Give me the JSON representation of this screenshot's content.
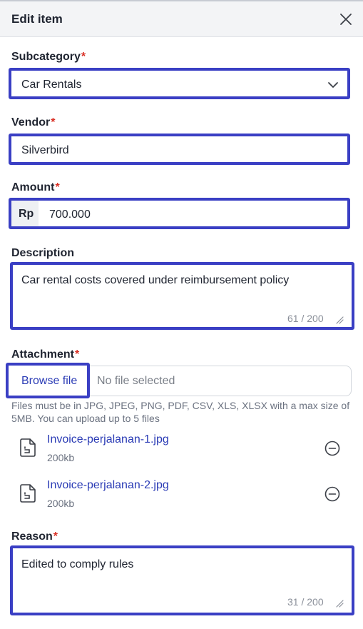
{
  "header": {
    "title": "Edit item"
  },
  "subcategory": {
    "label": "Subcategory",
    "required": "*",
    "value": "Car Rentals"
  },
  "vendor": {
    "label": "Vendor",
    "required": "*",
    "value": "Silverbird"
  },
  "amount": {
    "label": "Amount",
    "required": "*",
    "currency": "Rp",
    "value": "700.000"
  },
  "description": {
    "label": "Description",
    "value": "Car rental costs covered under reimbursement policy",
    "counter": "61 / 200"
  },
  "attachment": {
    "label": "Attachment",
    "required": "*",
    "browse_label": "Browse file",
    "status": "No file selected",
    "hint": "Files must be in JPG, JPEG, PNG, PDF, CSV, XLS, XLSX with a max size of 5MB. You can upload up to 5 files",
    "files": [
      {
        "name": "Invoice-perjalanan-1.jpg",
        "size": "200kb"
      },
      {
        "name": "Invoice-perjalanan-2.jpg",
        "size": "200kb"
      }
    ]
  },
  "reason": {
    "label": "Reason",
    "required": "*",
    "value": "Edited to comply rules",
    "counter": "31 / 200"
  },
  "colors": {
    "accent": "#3a3fc4",
    "required": "#d93025",
    "link": "#2a3bb5"
  }
}
